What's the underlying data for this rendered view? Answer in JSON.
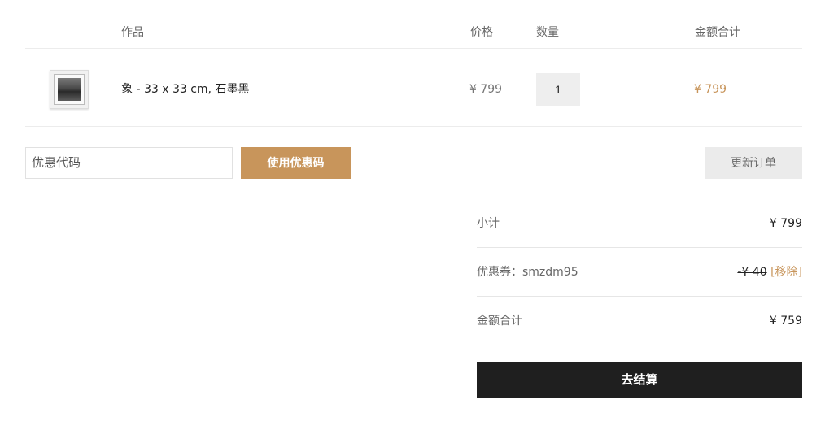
{
  "cart": {
    "headers": {
      "work": "作品",
      "price": "价格",
      "quantity": "数量",
      "total": "金额合计"
    },
    "items": [
      {
        "thumbnail_icon": "framed-photo-thumbnail",
        "name": "象 - 33 x 33 cm, 石墨黑",
        "price": "¥ 799",
        "quantity": "1",
        "subtotal": "¥ 799"
      }
    ]
  },
  "coupon": {
    "placeholder": "优惠代码",
    "apply_label": "使用优惠码",
    "update_label": "更新订单"
  },
  "totals": {
    "subtotal_label": "小计",
    "subtotal_value": "¥ 799",
    "coupon_label": "优惠券：smzdm95",
    "coupon_discount": "-¥ 40",
    "coupon_remove": "[移除]",
    "total_label": "金额合计",
    "total_value": "¥ 759",
    "checkout_label": "去结算"
  },
  "colors": {
    "accent": "#c8955b",
    "checkout": "#1f1f1f",
    "update_button": "#ebebeb"
  }
}
